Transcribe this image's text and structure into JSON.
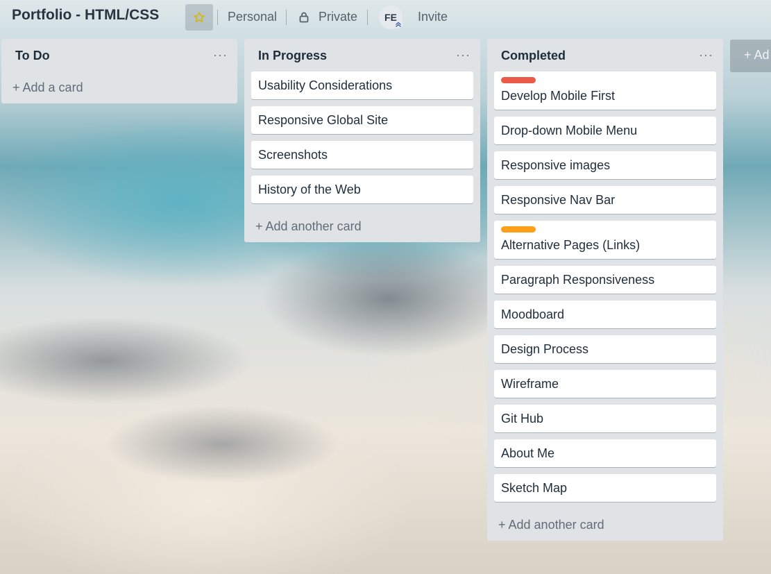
{
  "board": {
    "title": "Portfolio - HTML/CSS",
    "visibility_team": "Personal",
    "visibility": "Private",
    "member_initials": "FE",
    "invite_label": "Invite"
  },
  "colors": {
    "label_red": "#eb5a46",
    "label_orange": "#ff9f1a",
    "star": "#f2d600"
  },
  "lists": [
    {
      "title": "To Do",
      "menu": "···",
      "cards": [],
      "add_label": "+ Add a card"
    },
    {
      "title": "In Progress",
      "menu": "···",
      "cards": [
        {
          "text": "Usability Considerations"
        },
        {
          "text": "Responsive Global Site"
        },
        {
          "text": "Screenshots"
        },
        {
          "text": "History of the Web"
        }
      ],
      "add_label": "+ Add another card"
    },
    {
      "title": "Completed",
      "menu": "···",
      "cards": [
        {
          "text": "Develop Mobile First",
          "label": "red"
        },
        {
          "text": "Drop-down Mobile Menu"
        },
        {
          "text": "Responsive images"
        },
        {
          "text": "Responsive Nav Bar"
        },
        {
          "text": "Alternative Pages (Links)",
          "label": "orange"
        },
        {
          "text": "Paragraph Responsiveness"
        },
        {
          "text": "Moodboard"
        },
        {
          "text": "Design Process"
        },
        {
          "text": "Wireframe"
        },
        {
          "text": "Git Hub"
        },
        {
          "text": "About Me"
        },
        {
          "text": "Sketch Map"
        }
      ],
      "add_label": "+ Add another card"
    }
  ],
  "add_list_label": "+ Ad"
}
